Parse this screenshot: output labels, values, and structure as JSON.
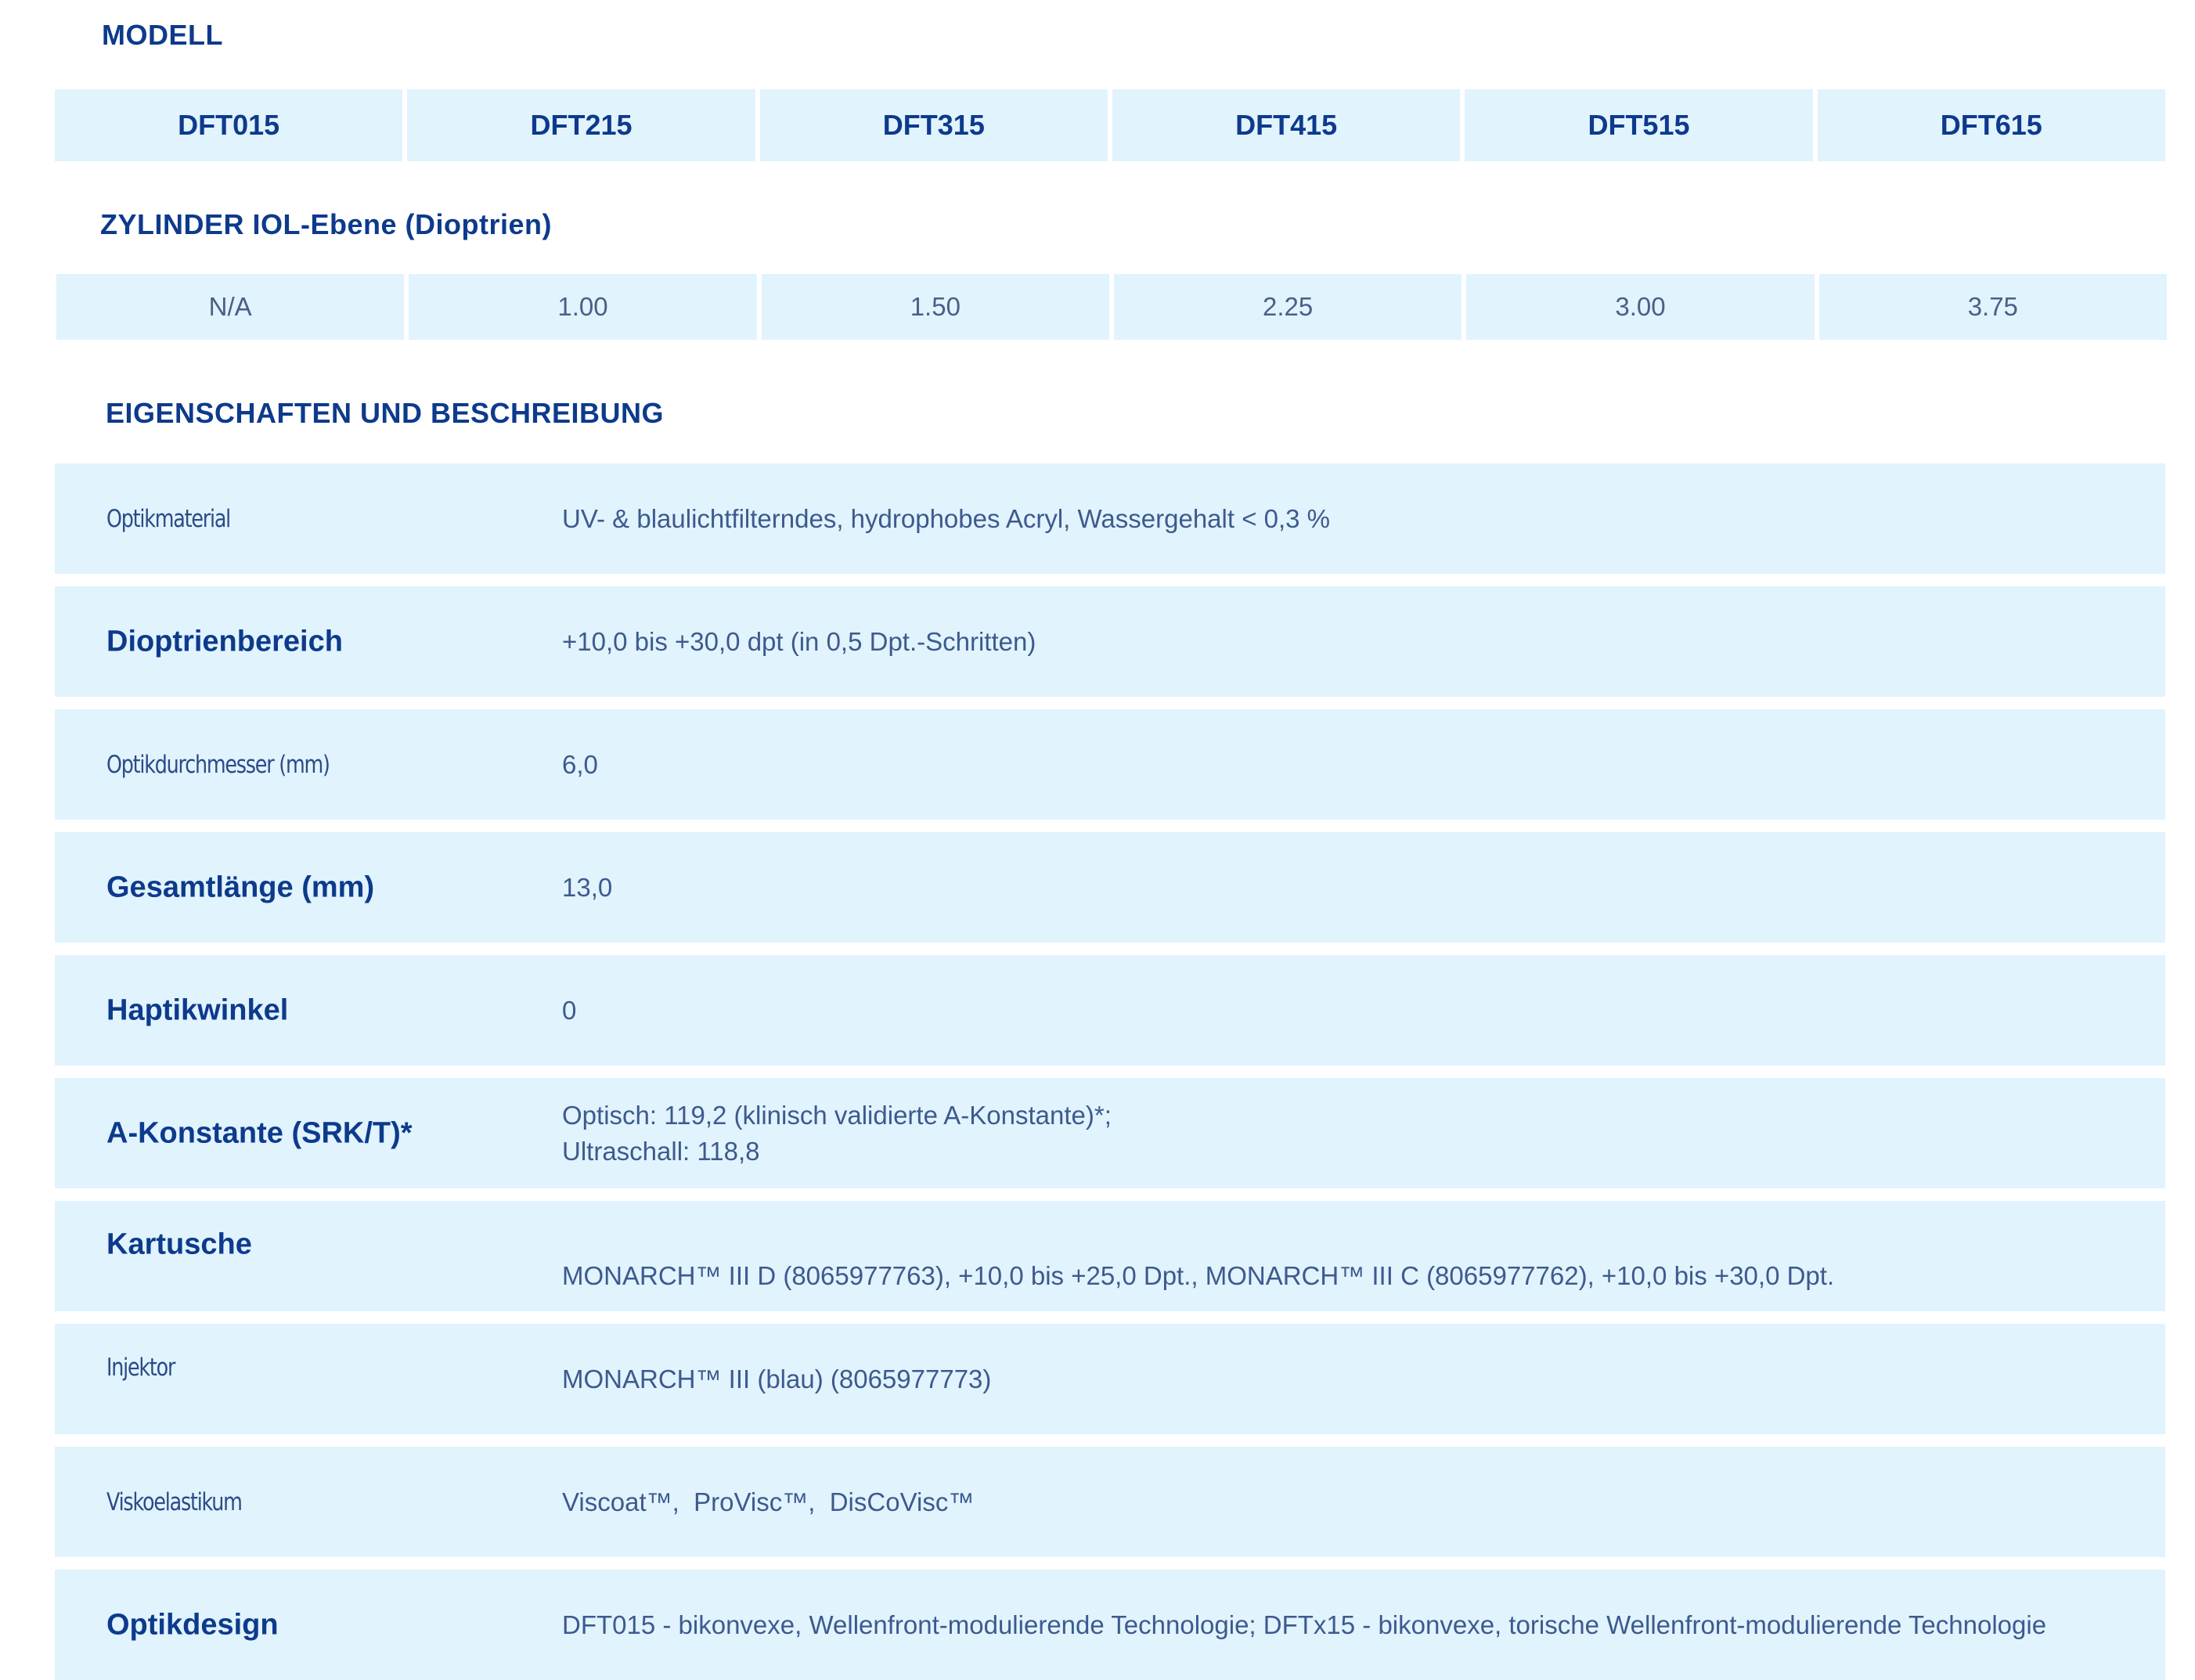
{
  "sections": {
    "model_title": "MODELL",
    "cylinder_title": "ZYLINDER IOL-Ebene (Dioptrien)",
    "properties_title": "EIGENSCHAFTEN UND BESCHREIBUNG"
  },
  "models": [
    "DFT015",
    "DFT215",
    "DFT315",
    "DFT415",
    "DFT515",
    "DFT615"
  ],
  "cylinder_values": [
    "N/A",
    "1.00",
    "1.50",
    "2.25",
    "3.00",
    "3.75"
  ],
  "properties": [
    {
      "label": "Optikmaterial",
      "value": "UV- & blaulichtfilterndes, hydrophobes Acryl, Wassergehalt < 0,3 %"
    },
    {
      "label": "Dioptrienbereich",
      "value": "+10,0 bis +30,0 dpt (in 0,5 Dpt.-Schritten)"
    },
    {
      "label": "Optikdurchmesser (mm)",
      "value": "6,0"
    },
    {
      "label": "Gesamtlänge (mm)",
      "value": "13,0"
    },
    {
      "label": "Haptikwinkel",
      "value": "0"
    },
    {
      "label": "A-Konstante (SRK/T)*",
      "value_line1": "Optisch: 119,2 (klinisch validierte A-Konstante)*;",
      "value_line2": "Ultraschall: 118,8"
    },
    {
      "label": "Kartusche",
      "value": "MONARCH™ III D (8065977763), +10,0 bis +25,0 Dpt., MONARCH™ III C (8065977762), +10,0 bis +30,0 Dpt."
    },
    {
      "label": "Injektor",
      "value": "MONARCH™ III (blau) (8065977773)"
    },
    {
      "label": "Viskoelastikum",
      "value": "Viscoat™,  ProVisc™,  DisCoVisc™"
    },
    {
      "label": "Optikdesign",
      "value": "DFT015 - bikonvexe, Wellenfront-modulierende Technologie; DFTx15 - bikonvexe, torische Wellenfront-modulierende Technologie"
    }
  ]
}
